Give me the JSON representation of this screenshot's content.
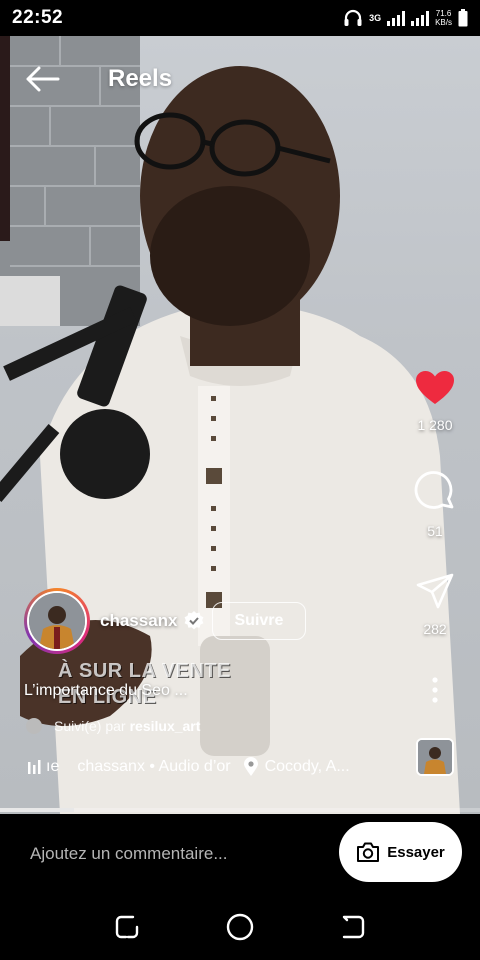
{
  "status_bar": {
    "time": "22:52",
    "network": "3G",
    "speed_value": "71.6",
    "speed_unit": "KB/s"
  },
  "header": {
    "title": "Reels",
    "back_icon": "arrow-left-icon"
  },
  "video": {
    "overlay_lines": [
      "À SUR LA VENTE",
      "EN LIGNE"
    ],
    "progress": 0.155
  },
  "actions": {
    "likes": "1 280",
    "comments": "51",
    "shares": "282",
    "like_color": "#ee2a3f"
  },
  "author": {
    "username": "chassanx",
    "follow_label": "Suivre"
  },
  "caption": "L’importance du Seo ...",
  "followed_by": {
    "prefix": "Suivi(e) par",
    "name": "resilux_art"
  },
  "audio": {
    "text": "chassanx • Audio d’or",
    "location": "Cocody, A...",
    "ticker_glyph": "ıe"
  },
  "comment_bar": {
    "placeholder": "Ajoutez un commentaire...",
    "try_label": "Essayer"
  }
}
